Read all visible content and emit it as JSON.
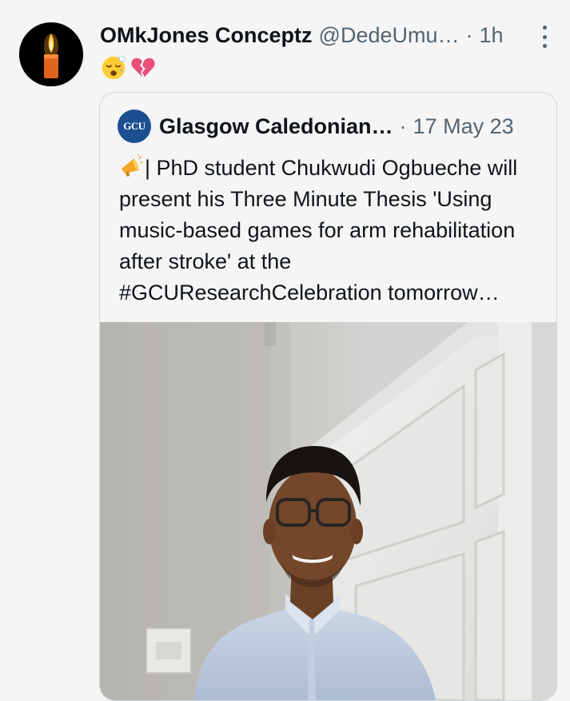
{
  "tweet": {
    "author_name": "OMkJones Conceptz",
    "author_handle": "@DedeUmu…",
    "separator": "·",
    "time": "1h",
    "emojis": [
      "sleepy-face-emoji",
      "broken-heart-emoji"
    ]
  },
  "quoted": {
    "author_name": "Glasgow Caledonian…",
    "separator": "·",
    "date": "17 May 23",
    "logo_text": "GCU",
    "text": "| PhD student Chukwudi Ogbueche will present his Three Minute Thesis 'Using music-based games for arm rehabilitation after stroke' at the #GCUResearchCelebration tomorrow…",
    "lead_icon": "megaphone-icon",
    "media": "photo of smiling man in light blue shirt and glasses standing by a white door"
  },
  "colors": {
    "background": "#f5f5f6",
    "text": "#0f1419",
    "secondary": "#536471",
    "border": "#cfd9de",
    "gcu_blue": "#1b4f92"
  }
}
